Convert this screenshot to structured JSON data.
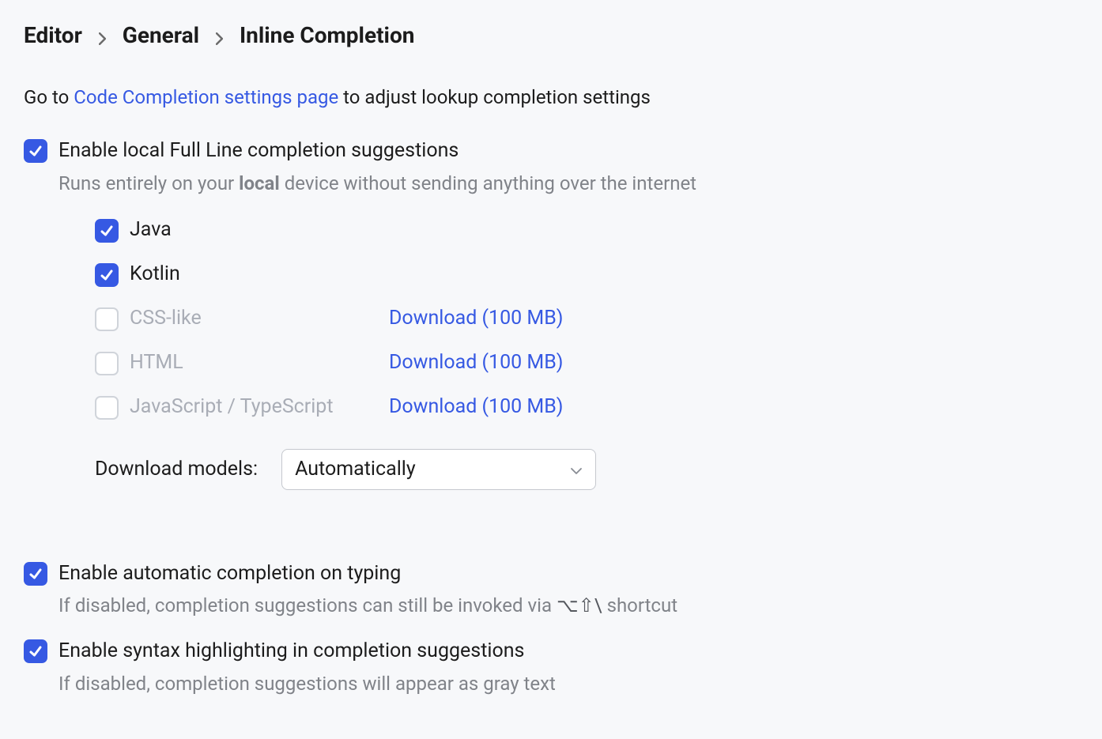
{
  "breadcrumb": {
    "part1": "Editor",
    "part2": "General",
    "part3": "Inline Completion"
  },
  "intro": {
    "prefix": "Go to ",
    "link": "Code Completion settings page",
    "suffix": " to adjust lookup completion settings"
  },
  "fullLine": {
    "label": "Enable local Full Line completion suggestions",
    "hint_pre": "Runs entirely on your ",
    "hint_bold": "local",
    "hint_post": " device without sending anything over the internet",
    "languages": [
      {
        "label": "Java",
        "download": ""
      },
      {
        "label": "Kotlin",
        "download": ""
      },
      {
        "label": "CSS-like",
        "download": "Download (100 MB)"
      },
      {
        "label": "HTML",
        "download": "Download (100 MB)"
      },
      {
        "label": "JavaScript / TypeScript",
        "download": "Download (100 MB)"
      }
    ],
    "downloadModelsLabel": "Download models:",
    "downloadModelsValue": "Automatically"
  },
  "autoTyping": {
    "label": "Enable automatic completion on typing",
    "hint_pre": "If disabled, completion suggestions can still be invoked via ",
    "hint_shortcut": "⌥⇧\\",
    "hint_post": " shortcut"
  },
  "syntaxHL": {
    "label": "Enable syntax highlighting in completion suggestions",
    "hint": "If disabled, completion suggestions will appear as gray text"
  }
}
